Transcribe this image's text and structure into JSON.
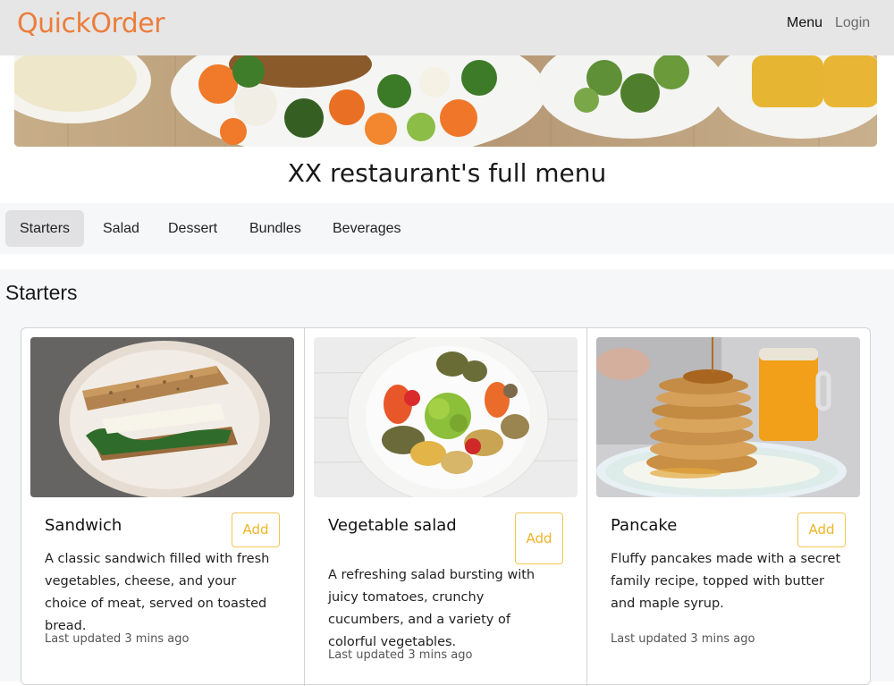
{
  "navbar": {
    "brand": "QuickOrder",
    "brand_color": "#ec7d3b",
    "links": [
      {
        "label": "Menu",
        "active": true
      },
      {
        "label": "Login",
        "active": false
      }
    ]
  },
  "banner": {
    "icon": "food-banner-image"
  },
  "page_title": "XX restaurant's full menu",
  "tabs": [
    {
      "label": "Starters",
      "active": true
    },
    {
      "label": "Salad",
      "active": false
    },
    {
      "label": "Dessert",
      "active": false
    },
    {
      "label": "Bundles",
      "active": false
    },
    {
      "label": "Beverages",
      "active": false
    }
  ],
  "section": {
    "title": "Starters"
  },
  "items": [
    {
      "name": "Sandwich",
      "description": "A classic sandwich filled with fresh vegetables, cheese, and your choice of meat, served on toasted bread.",
      "add_label": "Add",
      "updated": "Last updated 3 mins ago",
      "image": "sandwich-photo"
    },
    {
      "name": "Vegetable salad",
      "description": "A refreshing salad bursting with juicy tomatoes, crunchy cucumbers, and a variety of colorful vegetables.",
      "add_label": "Add",
      "updated": "Last updated 3 mins ago",
      "image": "vegetable-salad-photo"
    },
    {
      "name": "Pancake",
      "description": "Fluffy pancakes made with a secret family recipe, topped with butter and maple syrup.",
      "add_label": "Add",
      "updated": "Last updated 3 mins ago",
      "image": "pancake-photo"
    }
  ],
  "colors": {
    "accent_button": "#f0b429",
    "navbar_bg": "#e6e6e6",
    "section_bg": "#f6f7f9"
  }
}
